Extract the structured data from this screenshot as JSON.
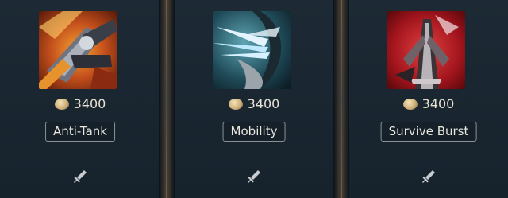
{
  "cards": [
    {
      "cost": "3400",
      "tag": "Anti-Tank",
      "icon": "anti-tank-item-icon",
      "slot_icon": "sword-slot-icon"
    },
    {
      "cost": "3400",
      "tag": "Mobility",
      "icon": "mobility-item-icon",
      "slot_icon": "sword-slot-icon"
    },
    {
      "cost": "3400",
      "tag": "Survive Burst",
      "icon": "survive-burst-item-icon",
      "slot_icon": "sword-slot-icon"
    }
  ],
  "colors": {
    "panel_bg": "#1d2a35",
    "tag_border": "#8a9196",
    "text": "#e9e6de",
    "coin": "#cfb07a"
  }
}
